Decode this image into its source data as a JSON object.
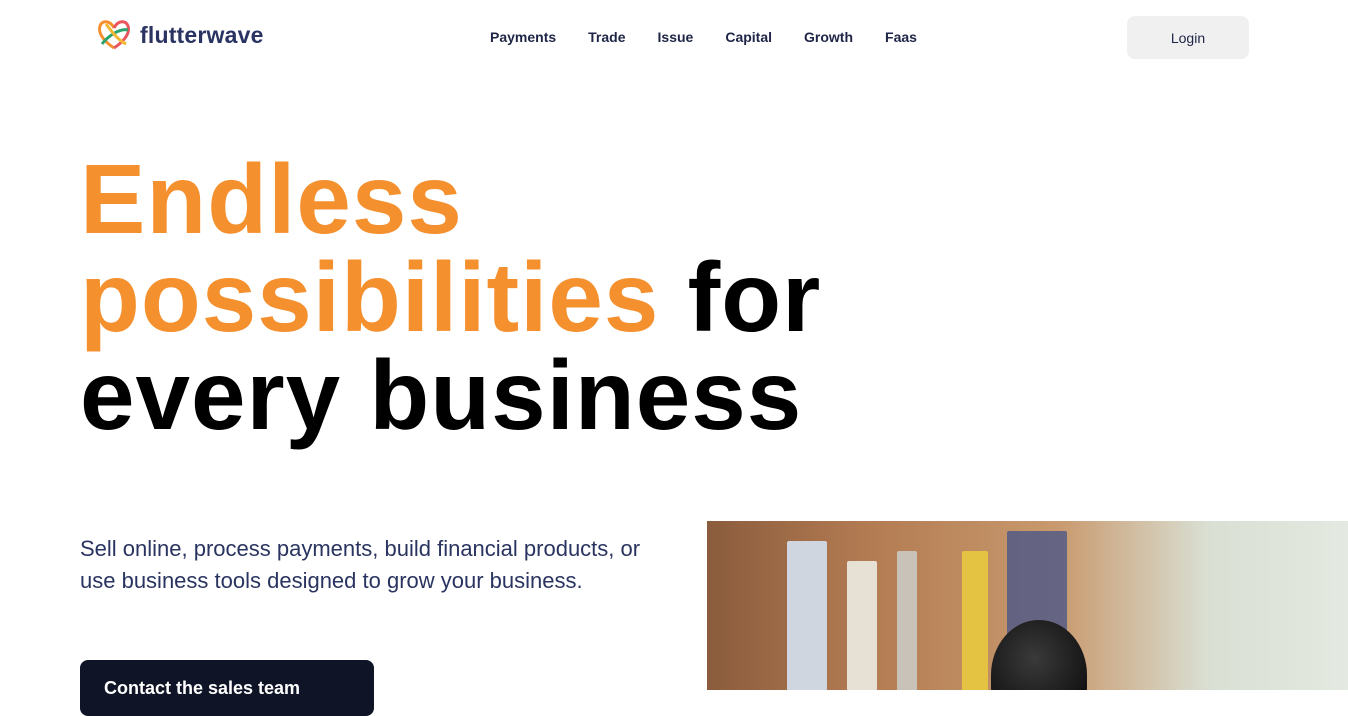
{
  "brand": {
    "name": "flutterwave",
    "colors": {
      "accent": "#f5902f",
      "navy": "#1e2546"
    }
  },
  "nav": {
    "items": [
      "Payments",
      "Trade",
      "Issue",
      "Capital",
      "Growth",
      "Faas"
    ],
    "login_label": "Login"
  },
  "hero": {
    "title_orange_1": "Endless",
    "title_orange_2": "possibilities",
    "title_black_2": "for",
    "title_black_3": "every business",
    "description": "Sell online, process payments, build financial products, or use business tools designed to grow your business.",
    "cta_label": "Contact the sales team"
  },
  "icons": [
    "flutterwave-logo-icon"
  ]
}
